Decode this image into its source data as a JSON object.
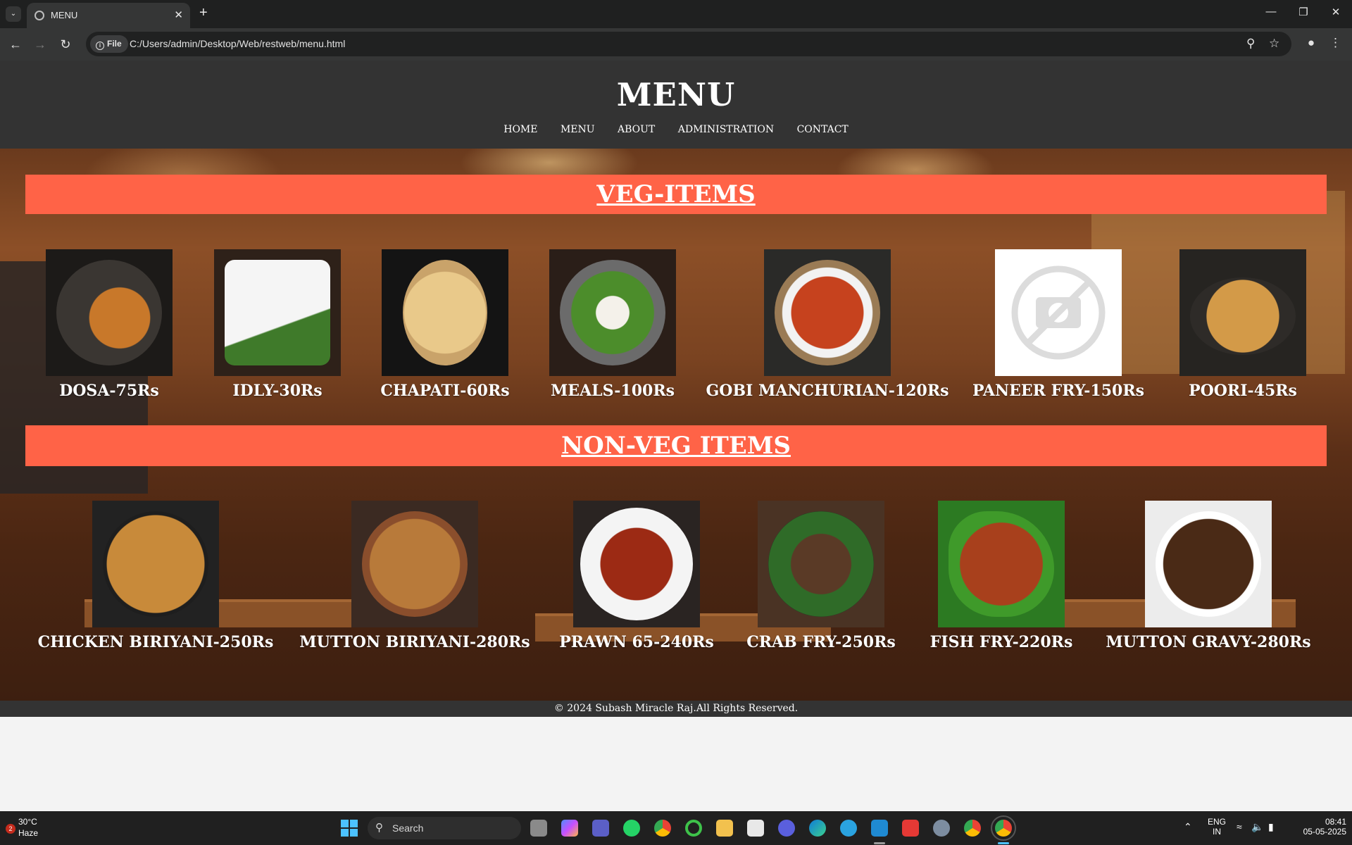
{
  "browser": {
    "tab_title": "MENU",
    "new_tab": "+",
    "site_chip": "File",
    "url": "C:/Users/admin/Desktop/Web/restweb/menu.html"
  },
  "page": {
    "title": "MENU",
    "nav": [
      "HOME",
      "MENU",
      "ABOUT",
      "ADMINISTRATION",
      "CONTACT"
    ],
    "veg_heading": "VEG-ITEMS",
    "veg_items": [
      {
        "label": "DOSA-75Rs"
      },
      {
        "label": "IDLY-30Rs"
      },
      {
        "label": "CHAPATI-60Rs"
      },
      {
        "label": "MEALS-100Rs"
      },
      {
        "label": "GOBI MANCHURIAN-120Rs"
      },
      {
        "label": "PANEER FRY-150Rs"
      },
      {
        "label": "POORI-45Rs"
      }
    ],
    "nonveg_heading": "NON-VEG ITEMS",
    "nonveg_items": [
      {
        "label": "CHICKEN BIRIYANI-250Rs"
      },
      {
        "label": "MUTTON BIRIYANI-280Rs"
      },
      {
        "label": "PRAWN 65-240Rs"
      },
      {
        "label": "CRAB FRY-250Rs"
      },
      {
        "label": "FISH FRY-220Rs"
      },
      {
        "label": "MUTTON GRAVY-280Rs"
      }
    ],
    "footer": "© 2024 Subash Miracle Raj.All Rights Reserved."
  },
  "taskbar": {
    "weather_temp": "30°C",
    "weather_cond": "Haze",
    "weather_badge": "2",
    "search_placeholder": "Search",
    "lang_top": "ENG",
    "lang_bottom": "IN",
    "time": "08:41",
    "date": "05-05-2025"
  },
  "colors": {
    "banner": "#ff6347",
    "header": "#333333"
  }
}
